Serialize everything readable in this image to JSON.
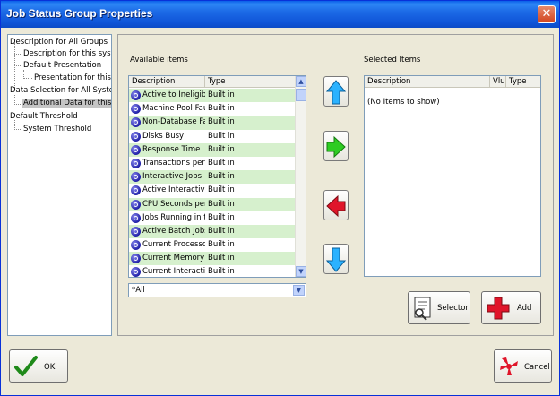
{
  "window": {
    "title": "Job Status Group Properties",
    "close_glyph": "✕"
  },
  "tree": {
    "items": [
      {
        "label": "Description for All Groups"
      },
      {
        "label": "Description for this system"
      },
      {
        "label": "Default Presentation"
      },
      {
        "label": "Presentation for this syste"
      },
      {
        "label": "Data Selection for All Systems"
      },
      {
        "label": "Additional Data for this syster",
        "selected": true
      },
      {
        "label": "Default Threshold"
      },
      {
        "label": "System Threshold"
      }
    ]
  },
  "available": {
    "label": "Available items",
    "columns": [
      "Description",
      "Type"
    ],
    "rows": [
      {
        "description": "Active to Ineligible...",
        "type": "Built in"
      },
      {
        "description": "Machine Pool Faults",
        "type": "Built in"
      },
      {
        "description": "Non-Database Faults",
        "type": "Built in"
      },
      {
        "description": "Disks Busy",
        "type": "Built in"
      },
      {
        "description": "Response Time",
        "type": "Built in"
      },
      {
        "description": "Transactions per H...",
        "type": "Built in"
      },
      {
        "description": "Interactive Jobs",
        "type": "Built in"
      },
      {
        "description": "Active Interactive ...",
        "type": "Built in"
      },
      {
        "description": "CPU Seconds per ...",
        "type": "Built in"
      },
      {
        "description": "Jobs Running in th...",
        "type": "Built in"
      },
      {
        "description": "Active Batch Jobs",
        "type": "Built in"
      },
      {
        "description": "Current Processors",
        "type": "Built in"
      },
      {
        "description": "Current Memory",
        "type": "Built in"
      },
      {
        "description": "Current Interactiv...",
        "type": "Built in"
      }
    ],
    "scroll_up": "▲",
    "scroll_down": "▼"
  },
  "filter": {
    "value": "*All",
    "arrow": "▼"
  },
  "selected": {
    "label": "Selected Items",
    "columns": [
      "Description",
      "Vlu",
      "Type"
    ],
    "empty_text": "(No Items to show)"
  },
  "buttons": {
    "selector": "Selector",
    "add": "Add",
    "ok": "OK",
    "cancel": "Cancel"
  },
  "colors": {
    "row_alt": "#d6f0cd",
    "arrow_up": "#2bb2ff",
    "arrow_right": "#2ecc23",
    "arrow_left": "#e0152a",
    "arrow_down": "#2bb2ff",
    "titlebar": "#0a5fe8"
  },
  "icons": {
    "arrows": [
      "arrow-up-icon",
      "arrow-right-icon",
      "arrow-left-icon",
      "arrow-down-icon"
    ],
    "row": "system-item-icon",
    "selector": "selector-icon",
    "add": "plus-icon",
    "ok": "checkmark-icon",
    "cancel": "cancel-icon"
  }
}
